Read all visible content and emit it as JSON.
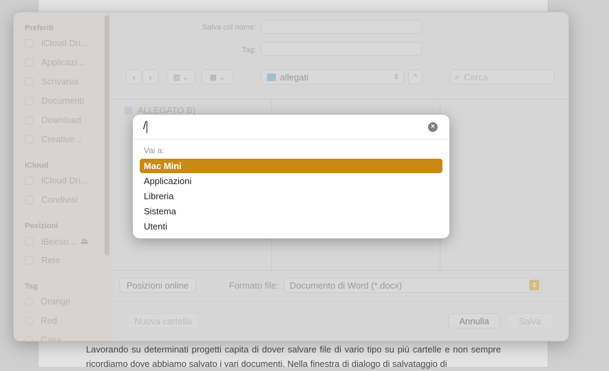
{
  "document": {
    "text": "Lavorando su determinati progetti capita di dover salvare file di vario tipo su più cartelle e non sempre ricordiamo dove abbiamo salvato i vari documenti. Nella finestra di dialogo di salvataggio di"
  },
  "sidebar": {
    "sections": [
      {
        "title": "Preferiti",
        "items": [
          "iCloud Dri...",
          "Applicazi...",
          "Scrivania",
          "Documenti",
          "Download",
          "Creative..."
        ]
      },
      {
        "title": "iCloud",
        "items": [
          "iCloud Dri...",
          "Condivisi"
        ]
      },
      {
        "title": "Posizioni",
        "items": [
          "iBeeso...",
          "Rete"
        ]
      },
      {
        "title": "Tag",
        "items": [
          "Orange",
          "Red",
          "Casa"
        ]
      }
    ]
  },
  "form": {
    "save_as_label": "Salva col nome:",
    "tag_label": "Tag:",
    "save_as_value": "",
    "tag_value": ""
  },
  "toolbar": {
    "location": "allegati",
    "search_placeholder": "Cerca"
  },
  "files": {
    "first": "ALLEGATO B)"
  },
  "bottom": {
    "online_button": "Posizioni online",
    "format_label": "Formato file:",
    "format_value": "Documento di Word (*.docx)",
    "new_folder": "Nuova cartella",
    "cancel": "Annulla",
    "save": "Salva"
  },
  "goto": {
    "input": "/",
    "header": "Vai a:",
    "options": [
      "Mac Mini",
      "Applicazioni",
      "Libreria",
      "Sistema",
      "Utenti"
    ],
    "selected": 0
  },
  "colors": {
    "accent": "#c98a14"
  }
}
